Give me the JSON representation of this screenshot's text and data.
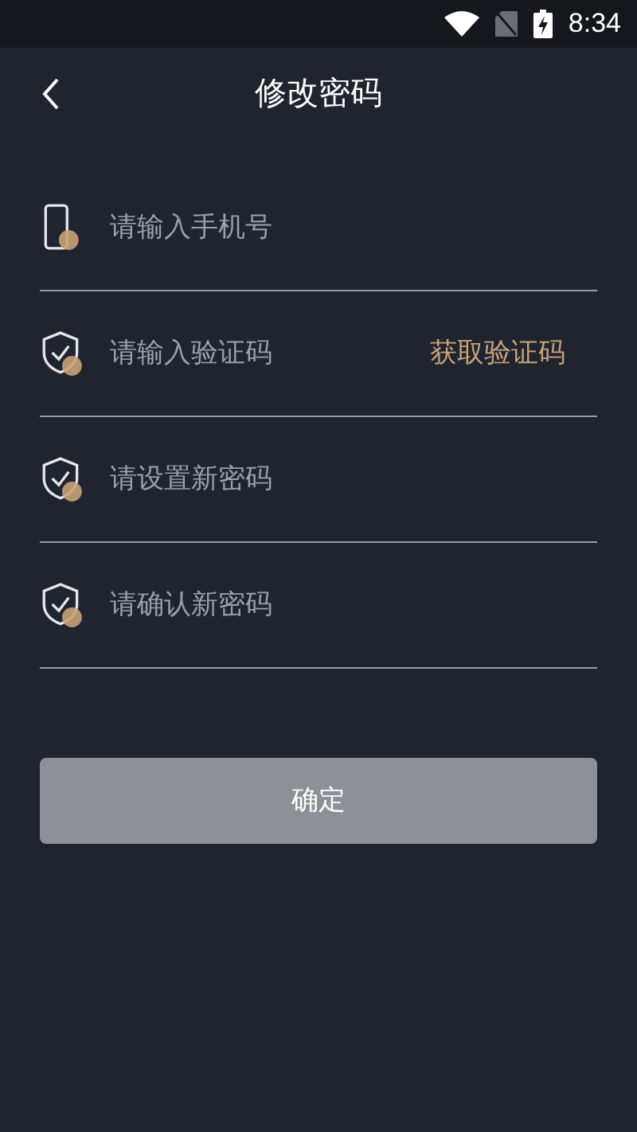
{
  "status_bar": {
    "time": "8:34"
  },
  "header": {
    "title": "修改密码"
  },
  "fields": [
    {
      "kind": "phone",
      "placeholder": "请输入手机号"
    },
    {
      "kind": "shield",
      "placeholder": "请输入验证码",
      "action": "获取验证码"
    },
    {
      "kind": "shield",
      "placeholder": "请设置新密码"
    },
    {
      "kind": "shield",
      "placeholder": "请确认新密码"
    }
  ],
  "submit": {
    "label": "确定",
    "disabled": true
  }
}
